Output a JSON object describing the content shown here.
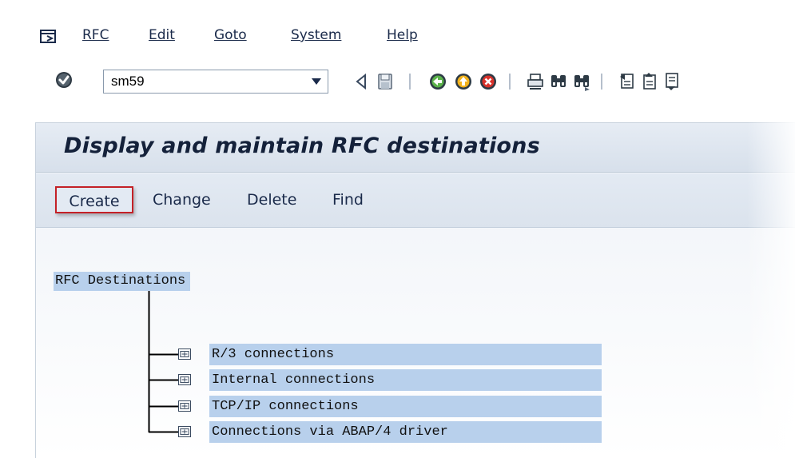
{
  "menubar": {
    "items": [
      {
        "label": "RFC"
      },
      {
        "label": "Edit"
      },
      {
        "label": "Goto"
      },
      {
        "label": "System"
      },
      {
        "label": "Help"
      }
    ]
  },
  "toolbar": {
    "command_value": "sm59",
    "icons": [
      "enter-icon",
      "back-icon",
      "save-icon",
      "back-green-icon",
      "exit-icon",
      "cancel-icon",
      "print-icon",
      "find-icon",
      "find-next-icon",
      "first-page-icon",
      "previous-page-icon",
      "next-page-icon"
    ]
  },
  "screen": {
    "title": "Display and maintain RFC destinations",
    "app_toolbar": {
      "create": "Create",
      "change": "Change",
      "delete": "Delete",
      "find": "Find"
    }
  },
  "tree": {
    "root": "RFC Destinations",
    "nodes": [
      {
        "label": "R/3 connections"
      },
      {
        "label": "Internal connections"
      },
      {
        "label": "TCP/IP connections"
      },
      {
        "label": "Connections via ABAP/4 driver"
      }
    ]
  },
  "colors": {
    "highlight_border": "#c42127",
    "tree_selection": "#b8d0ec",
    "title_text": "#14213a"
  }
}
